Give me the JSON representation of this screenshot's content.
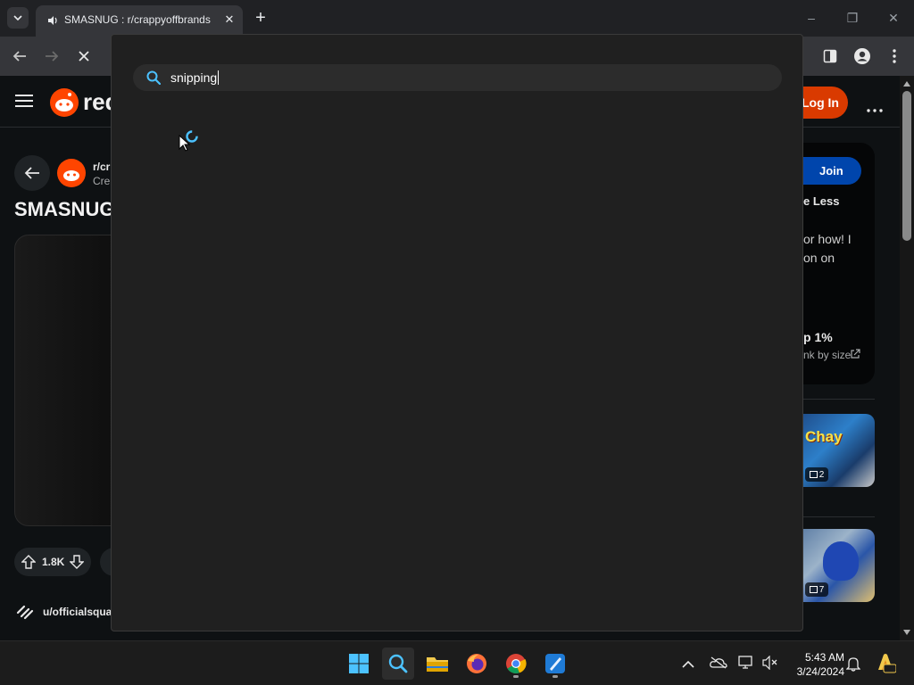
{
  "browser": {
    "tab": {
      "title": "SMASNUG : r/crappyoffbrands",
      "close": "✕"
    },
    "new_tab": "+",
    "window": {
      "minimize": "–",
      "restore": "❐",
      "close": "✕"
    }
  },
  "reddit": {
    "brand": "red",
    "login_label": "Log In",
    "join_label": "Join",
    "subreddit_partial": "r/cr",
    "meta_partial": "Cre",
    "post_title_partial": "SMASNUG",
    "sidebar_text_1": "e Less",
    "sidebar_text_2": "or how! I",
    "sidebar_text_3": "on on",
    "rank_title": "p 1%",
    "rank_sub": "nk by size",
    "upvotes": "1.8K",
    "author_partial": "u/officialsquar",
    "thumb1_count": "2",
    "thumb2_count": "7"
  },
  "search": {
    "query": "snipping",
    "icon": "search-icon"
  },
  "taskbar": {
    "time": "5:43 AM",
    "date": "3/24/2024",
    "apps": [
      "start-icon",
      "search-icon",
      "file-explorer-icon",
      "firefox-icon",
      "chrome-icon",
      "paint-icon"
    ]
  },
  "colors": {
    "reddit_orange": "#ff4500",
    "join_blue": "#0045ac",
    "login_orange": "#d93a00",
    "windows_blue": "#0078d4"
  }
}
